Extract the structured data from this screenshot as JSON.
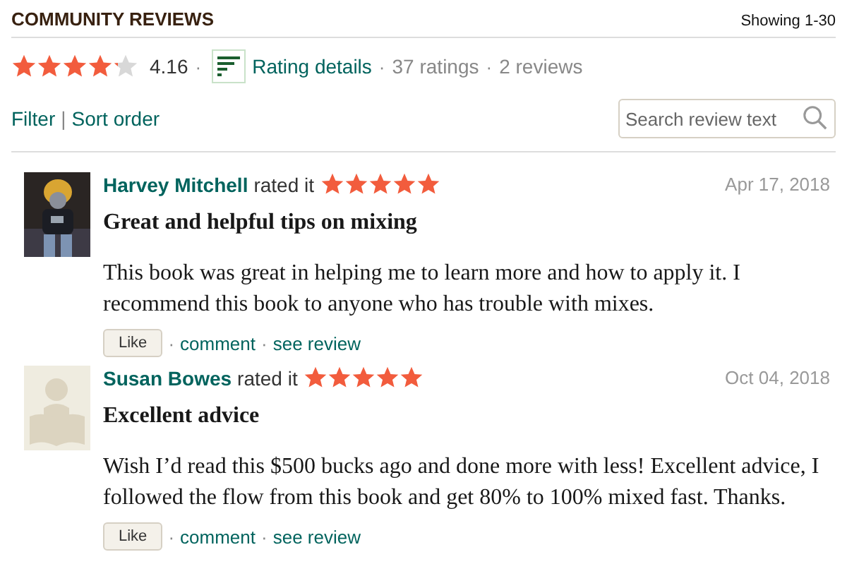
{
  "header": {
    "title": "COMMUNITY REVIEWS",
    "showing": "Showing 1-30"
  },
  "summary": {
    "stars": 4.16,
    "rating": "4.16",
    "details_link": "Rating details",
    "ratings": "37 ratings",
    "reviews": "2 reviews",
    "separators": [
      "·",
      "·",
      "·"
    ]
  },
  "controls": {
    "filter": "Filter",
    "separator": "|",
    "sort": "Sort order",
    "search": {
      "placeholder": "Search review text"
    }
  },
  "reviews": [
    {
      "avatar": {
        "kind": "picture"
      },
      "name": "Harvey Mitchell",
      "rated": "rated it",
      "stars": 5,
      "date": "Apr 17, 2018",
      "title": "Great and helpful tips on mixing",
      "body": "This book was great in helping me to learn more and how to apply it. I recommend this book to anyone who has trouble with mixes.",
      "like": "Like",
      "separators": [
        "·",
        "·"
      ],
      "comment": "comment",
      "see": "see review"
    },
    {
      "avatar": {
        "kind": "placeholder"
      },
      "name": "Susan Bowes",
      "rated": "rated it",
      "stars": 5,
      "date": "Oct 04, 2018",
      "title": "Excellent advice",
      "body": "Wish I’d read this $500 bucks ago and done more with less! Excellent advice, I followed the flow from this book and get 80% to 100% mixed fast. Thanks.",
      "like": "Like",
      "separators": [
        "·",
        "·"
      ],
      "comment": "comment",
      "see": "see review"
    }
  ]
}
